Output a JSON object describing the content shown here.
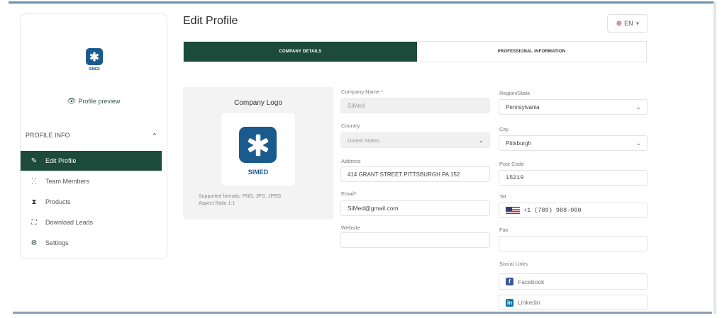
{
  "page": {
    "title": "Edit Profile"
  },
  "language": {
    "flag_icon": "us-flag-globe-icon",
    "value": "EN",
    "caret": "▾"
  },
  "sidebar": {
    "logo_text": "SIMED",
    "preview_label": "Profile preview",
    "section_label": "PROFILE INFO",
    "items": [
      {
        "label": "Edit Profile",
        "icon": "pencil-icon",
        "active": true
      },
      {
        "label": "Team Members",
        "icon": "team-icon",
        "active": false
      },
      {
        "label": "Products",
        "icon": "hourglass-icon",
        "active": false
      },
      {
        "label": "Download Leads",
        "icon": "expand-icon",
        "active": false
      },
      {
        "label": "Settings",
        "icon": "gear-icon",
        "active": false
      }
    ]
  },
  "tabs": [
    {
      "label": "COMPANY DETAILS",
      "active": true
    },
    {
      "label": "PROFESSIONAL INFORMATION",
      "active": false
    }
  ],
  "logo_card": {
    "title": "Company Logo",
    "logo_text": "SIMED",
    "formats": "Supported formats: PNG, JPG, JPEG",
    "aspect": "Aspect Ratio 1:1"
  },
  "form": {
    "company_name": {
      "label": "Company Name *",
      "value": "SiMed"
    },
    "country": {
      "label": "Country",
      "value": "United States"
    },
    "address": {
      "label": "Address",
      "value": "414 GRANT STREET PITTSBURGH PA 152"
    },
    "email": {
      "label": "Email*",
      "value": "SiMed@gmail.com"
    },
    "website": {
      "label": "Website",
      "value": ""
    },
    "region": {
      "label": "Region/State",
      "value": "Pennsylvania"
    },
    "city": {
      "label": "City",
      "value": "Pittsburgh"
    },
    "post_code": {
      "label": "Post Code",
      "value": "15219"
    },
    "tel": {
      "label": "Tel",
      "value": "+1 (789) 988-000"
    },
    "fax": {
      "label": "Fax",
      "value": ""
    },
    "social": {
      "label": "Social Links",
      "facebook": "Facebook",
      "linkedin": "Linkedin"
    }
  },
  "colors": {
    "primary": "#1c4a3b",
    "brand_blue": "#1b5a8d",
    "accent_green": "#2e5b48"
  }
}
